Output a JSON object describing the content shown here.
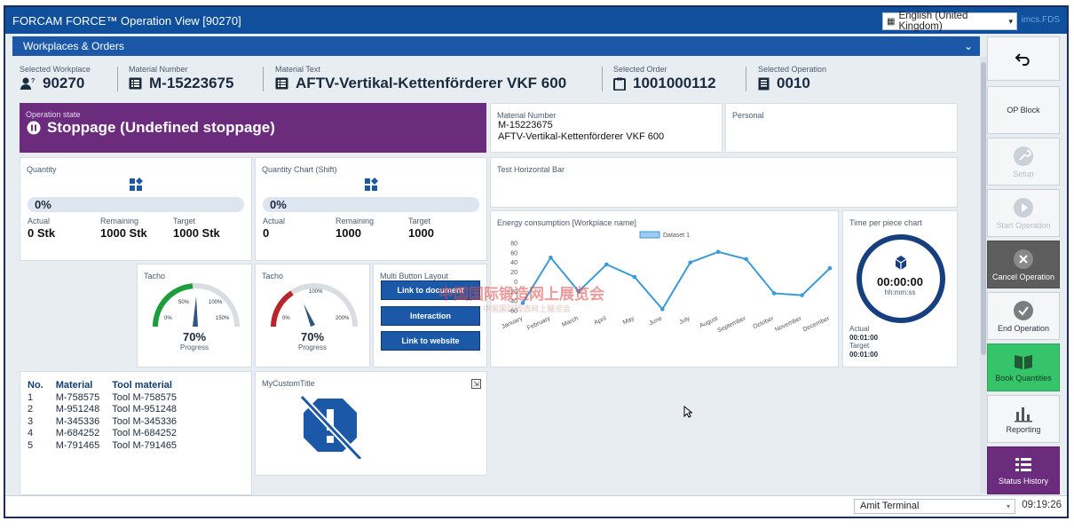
{
  "window": {
    "title": "FORCAM FORCE™ Operation View [90270]",
    "language": "English (United Kingdom)",
    "brand": "imcs.FDS"
  },
  "section": {
    "title": "Workplaces & Orders"
  },
  "selection": {
    "workplace_label": "Selected Workplace",
    "workplace": "90270",
    "material_number_label": "Material Number",
    "material_number": "M-15223675",
    "material_text_label": "Material Text",
    "material_text": "AFTV-Vertikal-Kettenförderer VKF 600",
    "order_label": "Selected Order",
    "order": "1001000112",
    "operation_label": "Selected Operation",
    "operation": "0010"
  },
  "op_state": {
    "label": "Operation state",
    "value": "Stoppage (Undefined stoppage)"
  },
  "material_card": {
    "label": "Material Number",
    "number": "M-15223675",
    "text": "AFTV-Vertikal-Kettenförderer VKF 600"
  },
  "personal_card": {
    "label": "Personal"
  },
  "quantity": {
    "title": "Quantity",
    "percent": "0%",
    "actual_label": "Actual",
    "actual": "0 Stk",
    "remaining_label": "Remaining",
    "remaining": "1000 Stk",
    "target_label": "Target",
    "target": "1000 Stk"
  },
  "quantity_chart": {
    "title": "Quantity Chart (Shift)",
    "percent": "0%",
    "actual_label": "Actual",
    "actual": "0",
    "remaining_label": "Remaining",
    "remaining": "1000",
    "target_label": "Target",
    "target": "1000"
  },
  "test_bar": {
    "title": "Test Horizontal Bar"
  },
  "tacho1": {
    "title": "Tacho",
    "value": "70%",
    "caption": "Progress",
    "t1": "0%",
    "t2": "50%",
    "t3": "100%",
    "t4": "150%",
    "color": "#1d9e3c"
  },
  "tacho2": {
    "title": "Tacho",
    "value": "70%",
    "caption": "Progress",
    "t1": "0%",
    "t2": "100%",
    "t3": "200%",
    "color": "#b8262a"
  },
  "multi": {
    "title": "Multi Button Layout",
    "b1": "Link to document",
    "b2": "Interaction",
    "b3": "Link to website"
  },
  "energy": {
    "title": "Energy consumption [Workplace name]"
  },
  "chart_data": {
    "type": "line",
    "title": "",
    "series": [
      {
        "name": "Dataset 1",
        "values": [
          -44,
          50,
          -20,
          36,
          10,
          -57,
          40,
          62,
          47,
          -24,
          -28,
          28
        ]
      }
    ],
    "categories": [
      "January",
      "February",
      "March",
      "April",
      "May",
      "June",
      "July",
      "August",
      "September",
      "October",
      "November",
      "December"
    ],
    "ylim": [
      -60,
      80
    ],
    "yticks": [
      "80",
      "60",
      "40",
      "20",
      "0",
      "-20",
      "-40",
      "-60"
    ],
    "grid": false,
    "legend": "top",
    "color": "#3b9ad9"
  },
  "tpp": {
    "title": "Time per piece chart",
    "time": "00:00:00",
    "unit": "hh:mm:ss",
    "actual_label": "Actual",
    "actual": "00:01:00",
    "target_label": "Target",
    "target": "00:01:00"
  },
  "tools": {
    "headers": [
      "No.",
      "Material",
      "Tool material"
    ],
    "rows": [
      [
        "1",
        "M-758575",
        "Tool M-758575"
      ],
      [
        "2",
        "M-951248",
        "Tool M-951248"
      ],
      [
        "3",
        "M-345336",
        "Tool M-345336"
      ],
      [
        "4",
        "M-684252",
        "Tool M-684252"
      ],
      [
        "5",
        "M-791465",
        "Tool M-791465"
      ]
    ]
  },
  "custom": {
    "title": "MyCustomTitle"
  },
  "right_panel": {
    "back": "",
    "op_block": "OP Block",
    "setup": "Setup",
    "start": "Start Operation",
    "cancel": "Cancel Operation",
    "end": "End Operation",
    "book": "Book Quantities",
    "reporting": "Reporting",
    "status": "Status History"
  },
  "footer": {
    "terminal": "Amit Terminal",
    "time": "09:19:26"
  },
  "watermark": {
    "line1": "中国国际锻造网上展览会",
    "line2": "中国国际锻造网上展览会"
  }
}
